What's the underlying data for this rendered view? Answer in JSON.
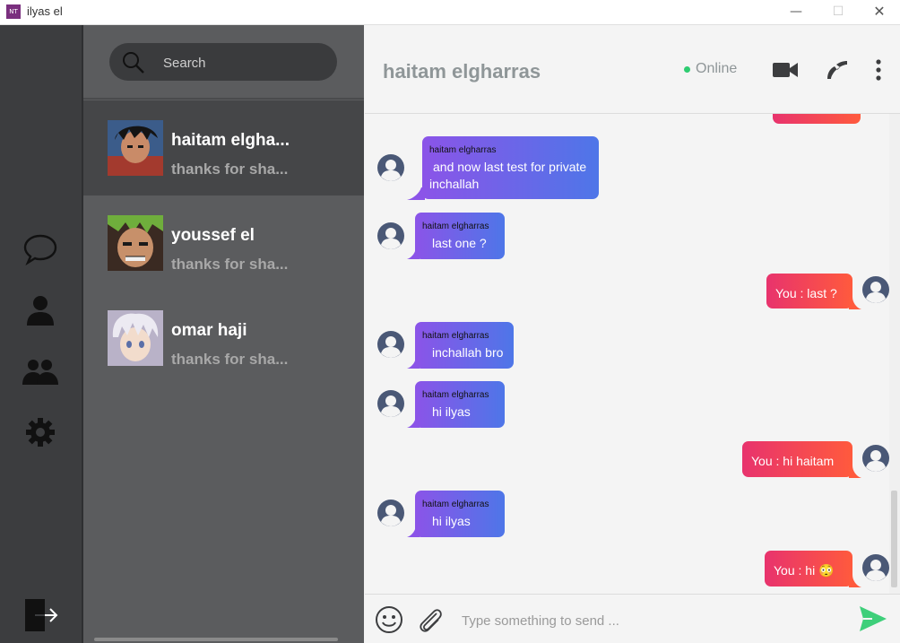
{
  "window": {
    "app_icon_text": "NT",
    "title": "ilyas el",
    "controls": {
      "minimize": "—",
      "maximize": "☐",
      "close": "✕"
    }
  },
  "nav": {
    "icons": [
      "chat-icon",
      "user-icon",
      "group-icon",
      "settings-icon",
      "logout-icon"
    ]
  },
  "search": {
    "placeholder": "Search"
  },
  "contacts": [
    {
      "name": "haitam elgha...",
      "preview": "thanks for sha...",
      "active": true
    },
    {
      "name": "youssef el",
      "preview": "thanks for sha...",
      "active": false
    },
    {
      "name": "omar haji",
      "preview": "thanks for sha...",
      "active": false
    }
  ],
  "chat": {
    "contact_name": "haitam elgharras",
    "status": "Online",
    "status_color": "#2ecc71"
  },
  "messages": [
    {
      "direction": "received",
      "sender": "haitam elgharras",
      "lines": [
        "and now last test for private",
        "inchallah"
      ]
    },
    {
      "direction": "received",
      "sender": "haitam elgharras",
      "lines": [
        "last one ?"
      ]
    },
    {
      "direction": "sent",
      "text": "You :  last ?"
    },
    {
      "direction": "received",
      "sender": "haitam elgharras",
      "lines": [
        "inchallah bro"
      ]
    },
    {
      "direction": "received",
      "sender": "haitam elgharras",
      "lines": [
        "hi ilyas"
      ]
    },
    {
      "direction": "sent",
      "text": "You :  hi haitam"
    },
    {
      "direction": "received",
      "sender": "haitam elgharras",
      "lines": [
        "hi ilyas"
      ]
    },
    {
      "direction": "sent",
      "text": "You :  hi 😳"
    }
  ],
  "composer": {
    "placeholder": "Type something to send ..."
  },
  "colors": {
    "received_gradient": [
      "#8b54e8",
      "#4e76e8"
    ],
    "sent_gradient": [
      "#e8336d",
      "#ff5a3d"
    ],
    "send_button": "#3ecf7a"
  }
}
